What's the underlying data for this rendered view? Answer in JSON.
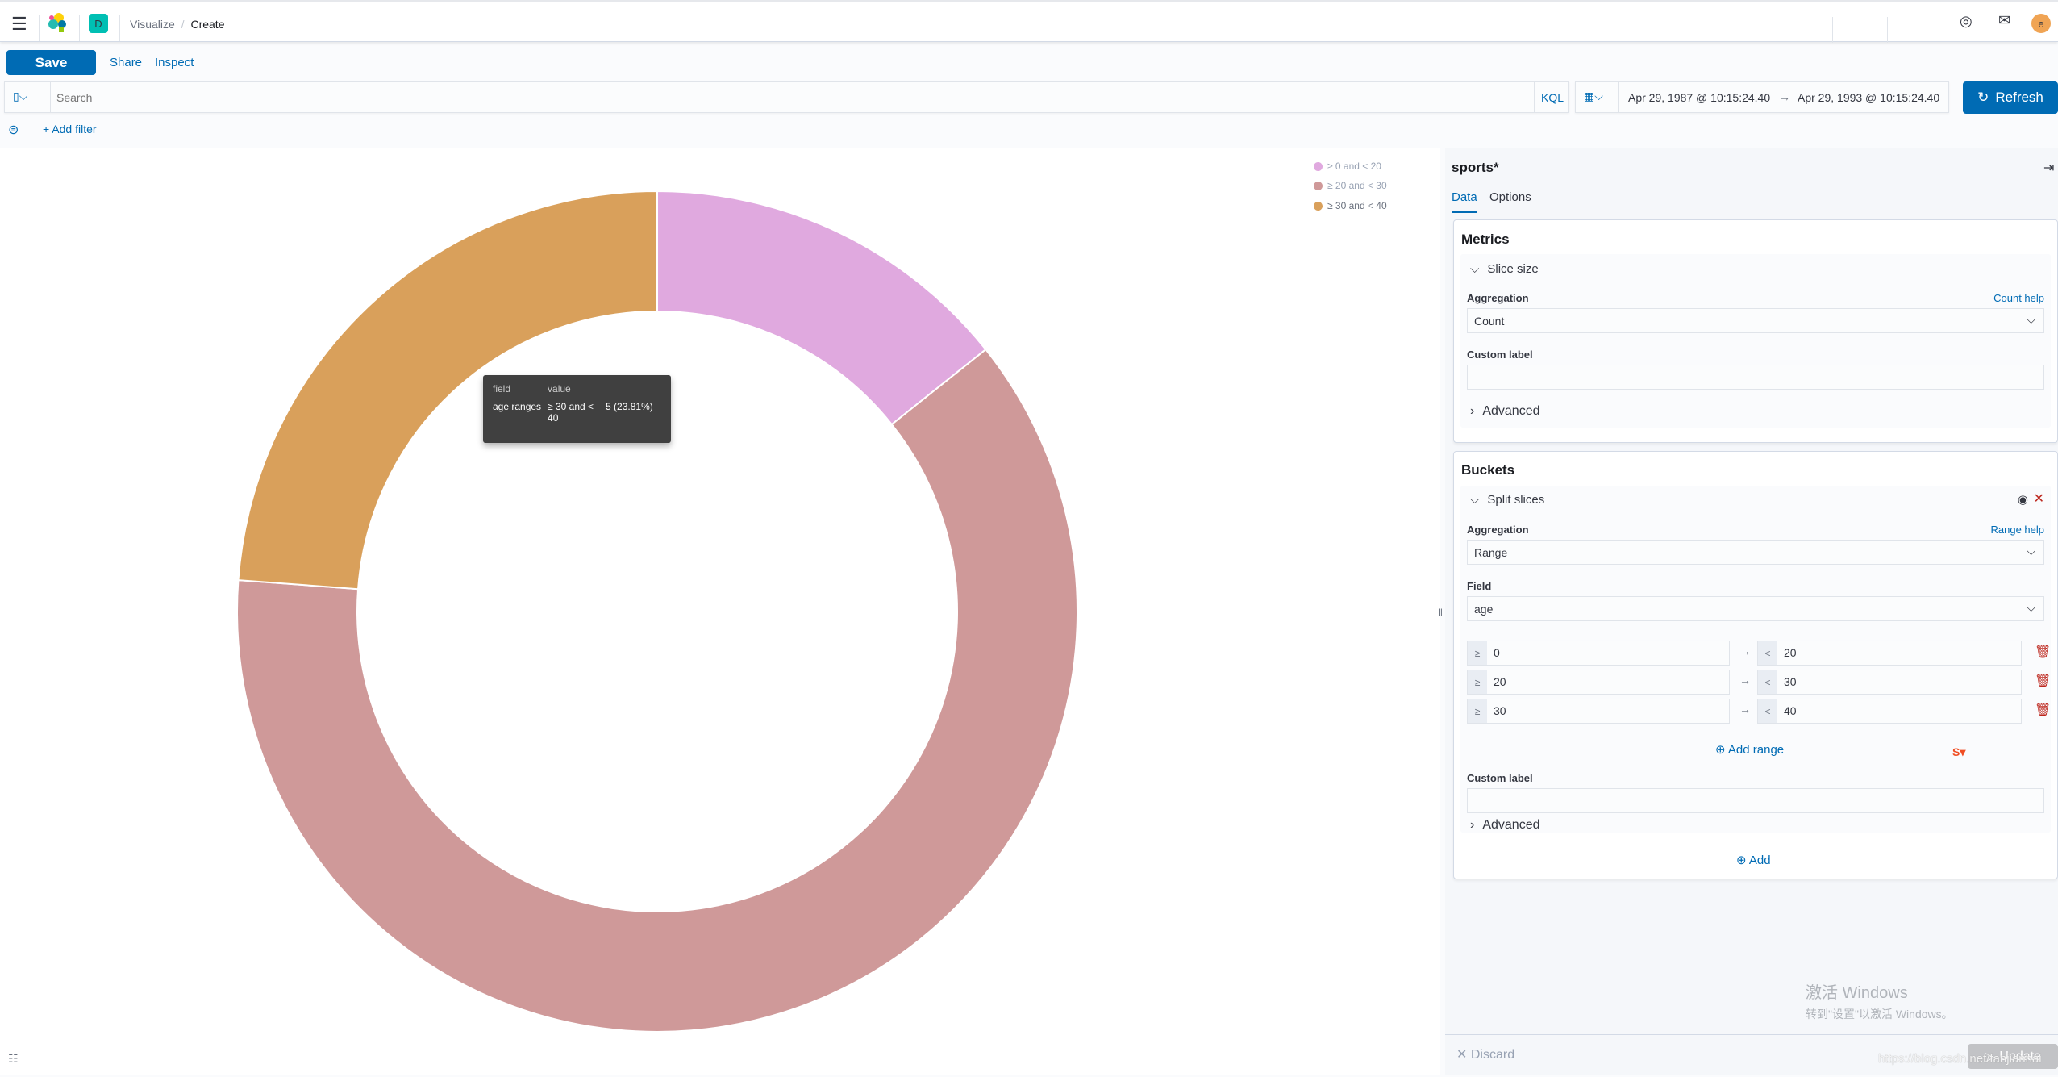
{
  "header": {
    "breadcrumbs": [
      "Visualize",
      "Create"
    ],
    "space_initial": "D",
    "user_initial": "e"
  },
  "toolbar": {
    "save": "Save",
    "share": "Share",
    "inspect": "Inspect"
  },
  "query": {
    "placeholder": "Search",
    "language": "KQL",
    "date_start": "Apr 29, 1987 @ 10:15:24.40",
    "date_arrow": "→",
    "date_end": "Apr 29, 1993 @ 10:15:24.40",
    "refresh": "Refresh"
  },
  "filters": {
    "add_filter": "+ Add filter"
  },
  "chart_data": {
    "type": "pie",
    "donut": true,
    "categories": [
      "≥ 0 and < 20",
      "≥ 20 and < 30",
      "≥ 30 and < 40"
    ],
    "values": [
      3,
      13,
      5
    ],
    "colors": [
      "#E0A9DF",
      "#CF9999",
      "#D9A05B"
    ],
    "legend_position": "top-right"
  },
  "tooltip": {
    "col_field": "field",
    "col_value": "value",
    "field": "age ranges",
    "range": "≥ 30 and < 40",
    "value": "5 (23.81%)"
  },
  "sidebar": {
    "index": "sports*",
    "tabs": [
      "Data",
      "Options"
    ],
    "metrics": {
      "title": "Metrics",
      "agg_title": "Slice size",
      "agg_label": "Aggregation",
      "help": "Count help",
      "agg_value": "Count",
      "custom_label": "Custom label",
      "advanced": "Advanced"
    },
    "buckets": {
      "title": "Buckets",
      "agg_title": "Split slices",
      "agg_label": "Aggregation",
      "help": "Range help",
      "agg_value": "Range",
      "field_label": "Field",
      "field_value": "age",
      "ranges": [
        {
          "from": "0",
          "to": "20"
        },
        {
          "from": "20",
          "to": "30"
        },
        {
          "from": "30",
          "to": "40"
        }
      ],
      "gte": "≥",
      "lt": "<",
      "add_range": "Add range",
      "custom_label": "Custom label",
      "advanced": "Advanced",
      "add": "Add"
    },
    "discard": "Discard",
    "update": "Update"
  },
  "watermark": {
    "line1": "激活 Windows",
    "line2": "转到\"设置\"以激活 Windows。",
    "url": "https://blog.csdn.net/fanjianhai"
  }
}
